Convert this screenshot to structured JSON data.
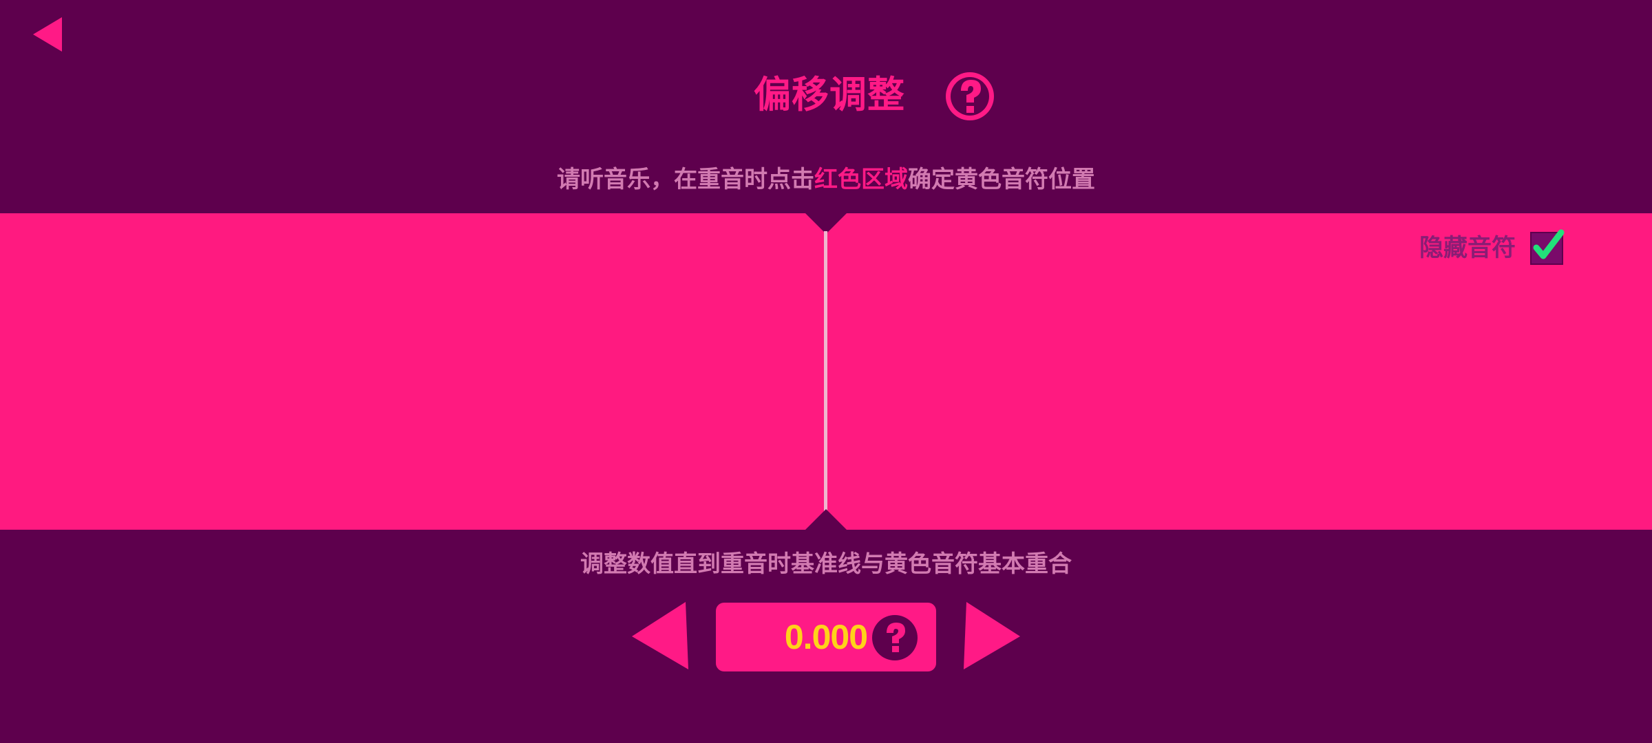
{
  "header": {
    "title": "偏移调整"
  },
  "instruction": {
    "before": "请听音乐，在重音时点击",
    "highlight": "红色区域",
    "after": "确定黄色音符位置"
  },
  "hide_notes": {
    "label": "隐藏音符",
    "checked": true
  },
  "adjust": {
    "instruction": "调整数值直到重音时基准线与黄色音符基本重合",
    "offset_value": "0.000"
  },
  "icons": {
    "back": "back-arrow-icon",
    "help": "question-mark-icon",
    "check": "checkmark-icon",
    "decrement": "left-triangle-icon",
    "increment": "right-triangle-icon"
  },
  "colors": {
    "background": "#5e004d",
    "accent_pink": "#ff1a86",
    "tap_area": "#ff1a80",
    "value_yellow": "#ffd21a",
    "check_green": "#22e07a",
    "instruction_text": "#d27ab1"
  }
}
